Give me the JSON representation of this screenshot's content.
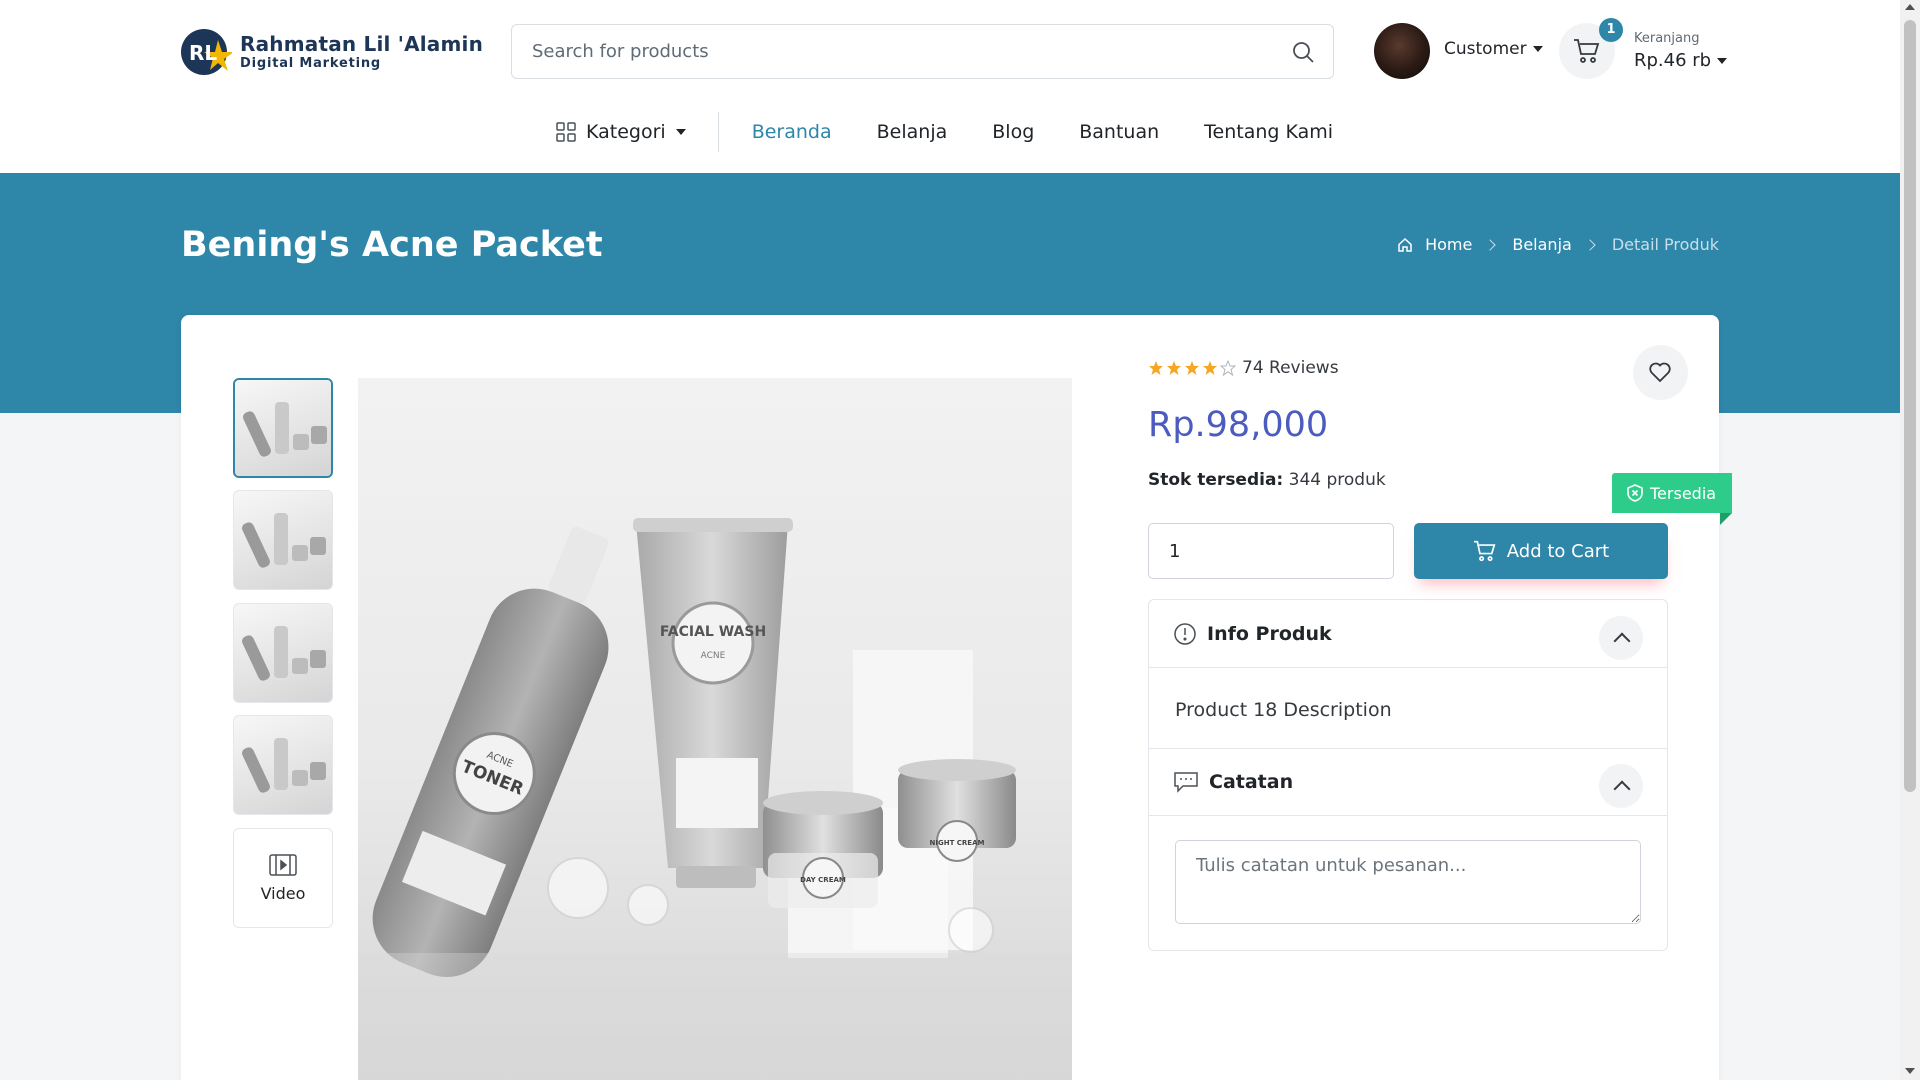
{
  "brand": {
    "name": "Rahmatan Lil 'Alamin",
    "tagline": "Digital Marketing",
    "mark": "RL",
    "colors": {
      "navy": "#1d3557",
      "gold": "#f2b705"
    }
  },
  "search": {
    "placeholder": "Search for products",
    "value": ""
  },
  "account": {
    "label": "Customer"
  },
  "cart": {
    "count": "1",
    "label": "Keranjang",
    "total": "Rp.46 rb"
  },
  "nav": {
    "category_label": "Kategori",
    "items": [
      {
        "label": "Beranda",
        "active": true
      },
      {
        "label": "Belanja",
        "active": false
      },
      {
        "label": "Blog",
        "active": false
      },
      {
        "label": "Bantuan",
        "active": false
      },
      {
        "label": "Tentang Kami",
        "active": false
      }
    ]
  },
  "page": {
    "title": "Bening's Acne Packet",
    "breadcrumb": [
      {
        "label": "Home"
      },
      {
        "label": "Belanja"
      },
      {
        "label": "Detail Produk"
      }
    ]
  },
  "gallery": {
    "thumbnails": 4,
    "selected_index": 0,
    "video_label": "Video",
    "main_image_labels": {
      "toner_top": "ACNE",
      "toner_main": "TONER",
      "wash_main": "FACIAL WASH",
      "wash_sub": "ACNE",
      "day_cream": "DAY CREAM",
      "night_cream": "NIGHT CREAM"
    }
  },
  "product": {
    "rating": 4,
    "rating_max": 5,
    "reviews": "74 Reviews",
    "price": "Rp.98,000",
    "stock_label": "Stok tersedia:",
    "stock_value": "344 produk",
    "availability": "Tersedia",
    "quantity": "1",
    "add_to_cart": "Add to Cart"
  },
  "info": {
    "info_title": "Info Produk",
    "description": "Product 18 Description",
    "notes_title": "Catatan",
    "notes_placeholder": "Tulis catatan untuk pesanan..."
  },
  "colors": {
    "primary": "#2e86a8",
    "price": "#4b5bbe",
    "available": "#2ecc8b",
    "star": "#f5a623"
  }
}
